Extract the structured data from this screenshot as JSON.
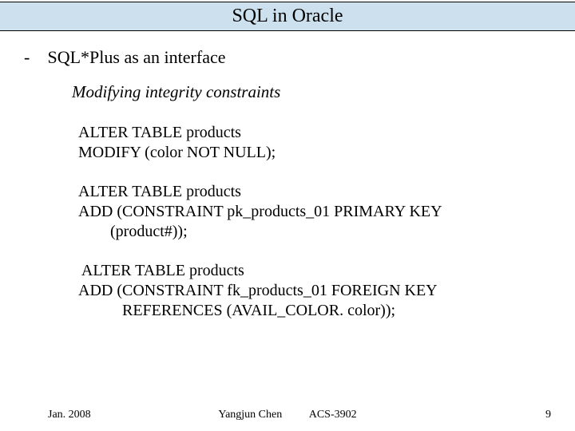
{
  "title": "SQL in Oracle",
  "bullet": {
    "dash": "-",
    "text": "SQL*Plus as an interface"
  },
  "subhead": "Modifying integrity constraints",
  "code1": "ALTER TABLE products\nMODIFY (color NOT NULL);",
  "code2": "ALTER TABLE products\nADD (CONSTRAINT pk_products_01 PRIMARY KEY\n        (product#));",
  "code3": " ALTER TABLE products\nADD (CONSTRAINT fk_products_01 FOREIGN KEY\n           REFERENCES (AVAIL_COLOR. color));",
  "footer": {
    "date": "Jan. 2008",
    "author": "Yangjun Chen",
    "course": "ACS-3902",
    "page": "9"
  }
}
